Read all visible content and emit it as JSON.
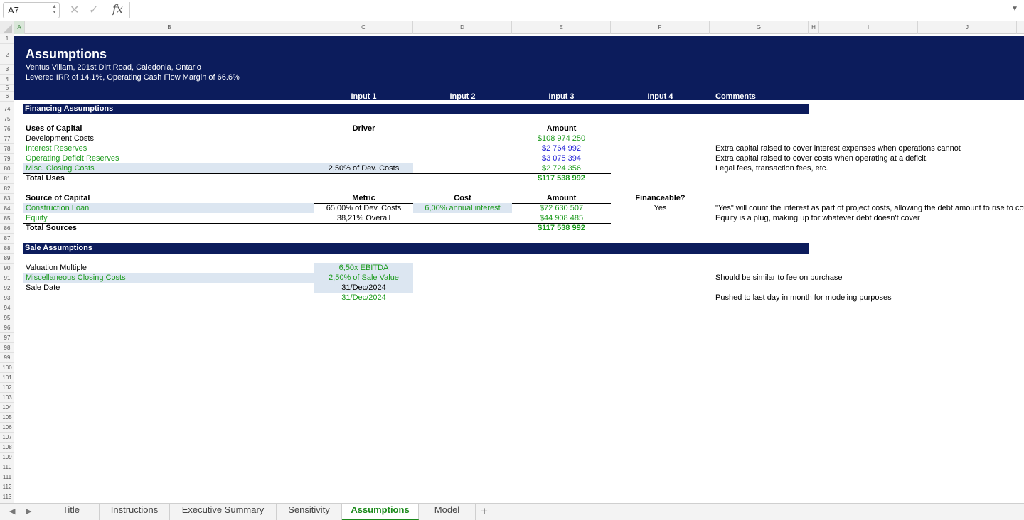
{
  "formula_bar": {
    "cell_ref": "A7",
    "fx_label": "fx",
    "formula": ""
  },
  "columns": [
    "A",
    "B",
    "C",
    "D",
    "E",
    "F",
    "G",
    "H",
    "I",
    "J"
  ],
  "rows": [
    "1",
    "2",
    "3",
    "4",
    "5",
    "6",
    "74",
    "75",
    "76",
    "77",
    "78",
    "79",
    "80",
    "81",
    "82",
    "83",
    "84",
    "85",
    "86",
    "87",
    "88",
    "89",
    "90",
    "91",
    "92",
    "93",
    "94",
    "95",
    "96",
    "97",
    "98",
    "99",
    "100",
    "101",
    "102",
    "103",
    "104",
    "105",
    "106",
    "107",
    "108",
    "109",
    "110",
    "111",
    "112",
    "113"
  ],
  "banner": {
    "title": "Assumptions",
    "subtitle": "Ventus Villam, 201st Dirt Road, Caledonia, Ontario",
    "subtitle2": "Levered IRR of 14.1%, Operating Cash Flow Margin of 66.6%",
    "input1": "Input 1",
    "input2": "Input 2",
    "input3": "Input 3",
    "input4": "Input 4",
    "comments": "Comments"
  },
  "financing": {
    "title": "Financing Assumptions",
    "uses_header": "Uses of Capital",
    "driver_header": "Driver",
    "amount_header": "Amount",
    "uses": [
      {
        "label": "Development Costs",
        "driver": "",
        "amount": "$108 974 250",
        "comment": ""
      },
      {
        "label": "Interest Reserves",
        "driver": "",
        "amount": "$2 764 992",
        "comment": "Extra capital raised to cover interest expenses when operations cannot"
      },
      {
        "label": "Operating Deficit Reserves",
        "driver": "",
        "amount": "$3 075 394",
        "comment": "Extra capital raised to cover costs when operating at a deficit."
      },
      {
        "label": "Misc. Closing Costs",
        "driver": "2,50% of Dev. Costs",
        "amount": "$2 724 356",
        "comment": "Legal fees, transaction fees, etc."
      }
    ],
    "total_uses_label": "Total Uses",
    "total_uses": "$117 538 992",
    "source_header": "Source of Capital",
    "metric_header": "Metric",
    "cost_header": "Cost",
    "amount_header2": "Amount",
    "financeable_header": "Financeable?",
    "sources": [
      {
        "label": "Construction Loan",
        "metric": "65,00% of Dev. Costs",
        "cost": "6,00% annual interest",
        "amount": "$72 630 507",
        "financeable": "Yes",
        "comment": "\"Yes\" will count the interest as part of project costs, allowing the debt amount to rise to cov"
      },
      {
        "label": "Equity",
        "metric": "38,21% Overall",
        "cost": "",
        "amount": "$44 908 485",
        "financeable": "",
        "comment": "Equity is a plug, making up for whatever debt doesn't cover"
      }
    ],
    "total_sources_label": "Total Sources",
    "total_sources": "$117 538 992"
  },
  "sale": {
    "title": "Sale Assumptions",
    "rows": [
      {
        "label": "Valuation Multiple",
        "value": "6,50x EBITDA",
        "comment": ""
      },
      {
        "label": "Miscellaneous Closing Costs",
        "value": "2,50% of Sale Value",
        "comment": "Should be similar to fee on purchase"
      },
      {
        "label": "Sale Date",
        "value": "31/Dec/2024",
        "comment": ""
      },
      {
        "label": "",
        "value": "31/Dec/2024",
        "comment": "Pushed to last day in month for modeling purposes"
      }
    ]
  },
  "tabs": [
    "Title",
    "Instructions",
    "Executive Summary",
    "Sensitivity",
    "Assumptions",
    "Model"
  ],
  "active_tab": "Assumptions",
  "add_tab": "+"
}
